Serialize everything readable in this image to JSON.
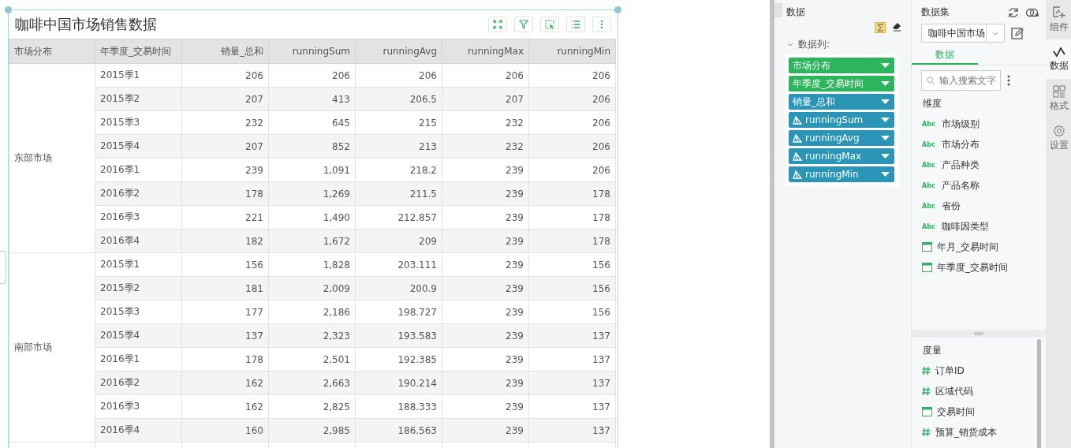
{
  "card": {
    "title": "咖啡中国市场销售数据"
  },
  "table": {
    "columns": [
      "市场分布",
      "年季度_交易时间",
      "销量_总和",
      "runningSum",
      "runningAvg",
      "runningMax",
      "runningMin"
    ],
    "groups": [
      {
        "label": "东部市场",
        "rows": [
          [
            "2015季1",
            "206",
            "206",
            "206",
            "206",
            "206"
          ],
          [
            "2015季2",
            "207",
            "413",
            "206.5",
            "207",
            "206"
          ],
          [
            "2015季3",
            "232",
            "645",
            "215",
            "232",
            "206"
          ],
          [
            "2015季4",
            "207",
            "852",
            "213",
            "232",
            "206"
          ],
          [
            "2016季1",
            "239",
            "1,091",
            "218.2",
            "239",
            "206"
          ],
          [
            "2016季2",
            "178",
            "1,269",
            "211.5",
            "239",
            "178"
          ],
          [
            "2016季3",
            "221",
            "1,490",
            "212.857",
            "239",
            "178"
          ],
          [
            "2016季4",
            "182",
            "1,672",
            "209",
            "239",
            "178"
          ]
        ]
      },
      {
        "label": "南部市场",
        "rows": [
          [
            "2015季1",
            "156",
            "1,828",
            "203.111",
            "239",
            "156"
          ],
          [
            "2015季2",
            "181",
            "2,009",
            "200.9",
            "239",
            "156"
          ],
          [
            "2015季3",
            "177",
            "2,186",
            "198.727",
            "239",
            "156"
          ],
          [
            "2015季4",
            "137",
            "2,323",
            "193.583",
            "239",
            "137"
          ],
          [
            "2016季1",
            "178",
            "2,501",
            "192.385",
            "239",
            "137"
          ],
          [
            "2016季2",
            "162",
            "2,663",
            "190.214",
            "239",
            "137"
          ],
          [
            "2016季3",
            "162",
            "2,825",
            "188.333",
            "239",
            "137"
          ],
          [
            "2016季4",
            "160",
            "2,985",
            "186.563",
            "239",
            "137"
          ]
        ]
      }
    ]
  },
  "data_panel": {
    "title": "数据",
    "section": {
      "label": "数据列:",
      "expanded": true
    },
    "fields": [
      {
        "label": "市场分布",
        "kind": "dimension"
      },
      {
        "label": "年季度_交易时间",
        "kind": "dimension"
      },
      {
        "label": "销量_总和",
        "kind": "measure"
      },
      {
        "label": "runningSum",
        "kind": "calculated"
      },
      {
        "label": "runningAvg",
        "kind": "calculated"
      },
      {
        "label": "runningMax",
        "kind": "calculated"
      },
      {
        "label": "runningMin",
        "kind": "calculated"
      }
    ]
  },
  "dataset_panel": {
    "title": "数据集",
    "dataset": "咖啡中国市场",
    "tabs": [
      {
        "label": "数据",
        "selected": true
      }
    ],
    "search": {
      "placeholder": "输入搜索文字"
    },
    "dimensions": {
      "title": "维度",
      "items": [
        {
          "label": "市场级别",
          "kind": "text",
          "icon_text": "Abc"
        },
        {
          "label": "市场分布",
          "kind": "text",
          "icon_text": "Abc"
        },
        {
          "label": "产品种类",
          "kind": "text",
          "icon_text": "Abc"
        },
        {
          "label": "产品名称",
          "kind": "text",
          "icon_text": "Abc"
        },
        {
          "label": "省份",
          "kind": "text",
          "icon_text": "Abc"
        },
        {
          "label": "咖啡因类型",
          "kind": "text",
          "icon_text": "Abc"
        },
        {
          "label": "年月_交易时间",
          "kind": "date"
        },
        {
          "label": "年季度_交易时间",
          "kind": "date"
        }
      ]
    },
    "measures": {
      "title": "度量",
      "items": [
        {
          "label": "订单ID",
          "kind": "number"
        },
        {
          "label": "区域代码",
          "kind": "number"
        },
        {
          "label": "交易时间",
          "kind": "date"
        },
        {
          "label": "预算_销货成本",
          "kind": "number"
        }
      ]
    }
  },
  "side_tabs": [
    {
      "label": "组件",
      "kind": "component",
      "selected": false
    },
    {
      "label": "数据",
      "kind": "data",
      "selected": true
    },
    {
      "label": "格式",
      "kind": "format",
      "selected": false
    },
    {
      "label": "设置",
      "kind": "settings",
      "selected": false
    }
  ]
}
